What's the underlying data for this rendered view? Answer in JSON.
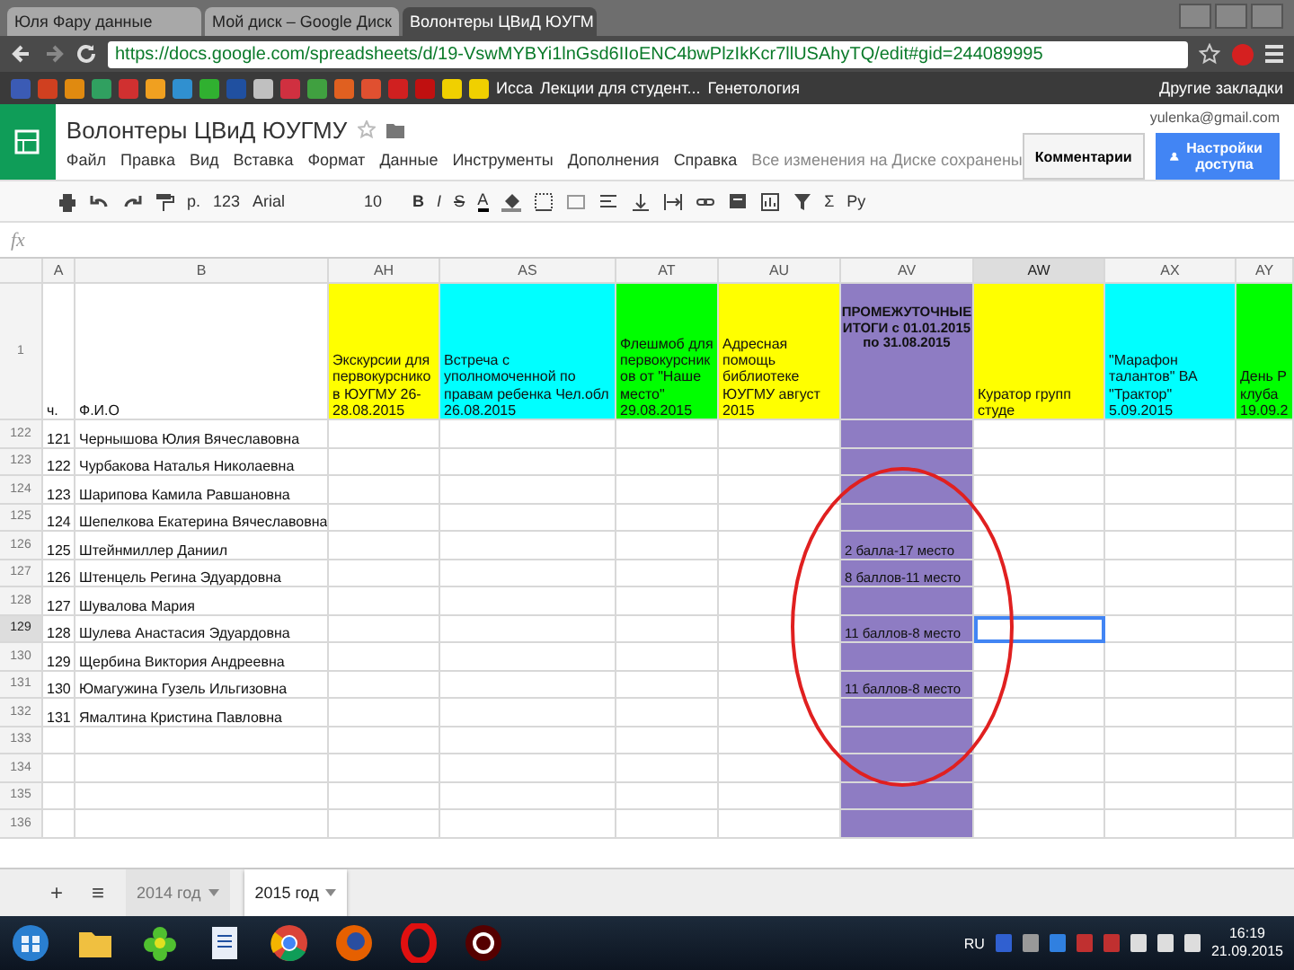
{
  "browser": {
    "tabs": [
      {
        "label": "Юля Фару данные",
        "selected": false
      },
      {
        "label": "Мой диск – Google Диск",
        "selected": false
      },
      {
        "label": "Волонтеры ЦВиД ЮУГМ",
        "selected": true
      }
    ],
    "url": "https://docs.google.com/spreadsheets/d/19-VswMYBYi1lnGsd6IIoENC4bwPlzIkKcr7llUSAhyTQ/edit#gid=244089995",
    "bookmarks": [
      "Исса",
      "Лекции для студент...",
      "Генетология"
    ],
    "other_bookmarks": "Другие закладки"
  },
  "docs": {
    "title": "Волонтеры ЦВиД ЮУГМУ",
    "account": "yulenka@gmail.com",
    "menu": [
      "Файл",
      "Правка",
      "Вид",
      "Вставка",
      "Формат",
      "Данные",
      "Инструменты",
      "Дополнения",
      "Справка"
    ],
    "save_status": "Все изменения на Диске сохранены",
    "comments_button": "Комментарии",
    "share_button": "Настройки доступа"
  },
  "toolbar": {
    "zoom": "р.",
    "number_format": "123",
    "font": "Arial",
    "size": "10",
    "bold": "B",
    "italic": "I",
    "strike": "S",
    "text_color": "A",
    "sum": "Σ",
    "input_tools": "Ру"
  },
  "formula_bar": {
    "label": "fx"
  },
  "sheet": {
    "columns": [
      {
        "letter": "A",
        "header": "ч.",
        "color": "#ffffff",
        "selected": false
      },
      {
        "letter": "B",
        "header": "Ф.И.О",
        "color": "#ffffff",
        "selected": false
      },
      {
        "letter": "AH",
        "header": "Экскурсии для первокурсников ЮУГМУ 26-28.08.2015",
        "color": "#ffff00",
        "selected": false
      },
      {
        "letter": "AS",
        "header": "Встреча с уполномоченной по правам ребенка Чел.обл 26.08.2015",
        "color": "#00ffff",
        "selected": false
      },
      {
        "letter": "AT",
        "header": "Флешмоб для первокурсников от \"Наше место\" 29.08.2015",
        "color": "#00ff00",
        "selected": false
      },
      {
        "letter": "AU",
        "header": "Адресная помощь библиотеке ЮУГМУ август 2015",
        "color": "#ffff00",
        "selected": false
      },
      {
        "letter": "AV",
        "header": "ПРОМЕЖУТОЧНЫЕ ИТОГИ с 01.01.2015 по 31.08.2015",
        "color": "#8e7cc3",
        "selected": false
      },
      {
        "letter": "AW",
        "header": "Куратор групп студе",
        "color": "#ffff00",
        "selected": true
      },
      {
        "letter": "AX",
        "header": "\"Марафон талантов\" ВА \"Трактор\" 5.09.2015",
        "color": "#00ffff",
        "selected": false
      },
      {
        "letter": "AY",
        "header": "День Р клуба 19.09.2",
        "color": "#00ff00",
        "selected": false
      }
    ],
    "header_row": "1",
    "rows": [
      {
        "row": "122",
        "a": "121",
        "b": "Чернышова Юлия Вячеславовна",
        "selected": false
      },
      {
        "row": "123",
        "a": "122",
        "b": "Чурбакова Наталья Николаевна",
        "selected": false
      },
      {
        "row": "124",
        "a": "123",
        "b": "Шарипова Камила Равшановна",
        "selected": false
      },
      {
        "row": "125",
        "a": "124",
        "b": "Шепелкова Екатерина Вячеславовна",
        "selected": false
      },
      {
        "row": "126",
        "a": "125",
        "b": "Штейнмиллер Даниил",
        "av": "2 балла-17 место",
        "selected": false
      },
      {
        "row": "127",
        "a": "126",
        "b": "Штенцель Регина Эдуардовна",
        "av": "8 баллов-11 место",
        "selected": false
      },
      {
        "row": "128",
        "a": "127",
        "b": "Шувалова Мария",
        "selected": false
      },
      {
        "row": "129",
        "a": "128",
        "b": "Шулева Анастасия Эдуардовна",
        "av": "11 баллов-8 место",
        "selected": true
      },
      {
        "row": "130",
        "a": "129",
        "b": "Щербина Виктория Андреевна",
        "selected": false
      },
      {
        "row": "131",
        "a": "130",
        "b": "Юмагужина Гузель Ильгизовна",
        "av": "11 баллов-8 место",
        "selected": false
      },
      {
        "row": "132",
        "a": "131",
        "b": "Ямалтина Кристина Павловна",
        "selected": false
      },
      {
        "row": "133",
        "selected": false
      },
      {
        "row": "134",
        "selected": false
      },
      {
        "row": "135",
        "selected": false
      },
      {
        "row": "136",
        "selected": false
      }
    ],
    "annotation": {
      "kind": "ellipse",
      "color": "#e02020"
    }
  },
  "sheet_tabs": {
    "add": "+",
    "list": "≡",
    "tabs": [
      {
        "label": "2014 год",
        "selected": false
      },
      {
        "label": "2015 год",
        "selected": true
      }
    ]
  },
  "taskbar": {
    "language": "RU",
    "time": "16:19",
    "date": "21.09.2015"
  }
}
